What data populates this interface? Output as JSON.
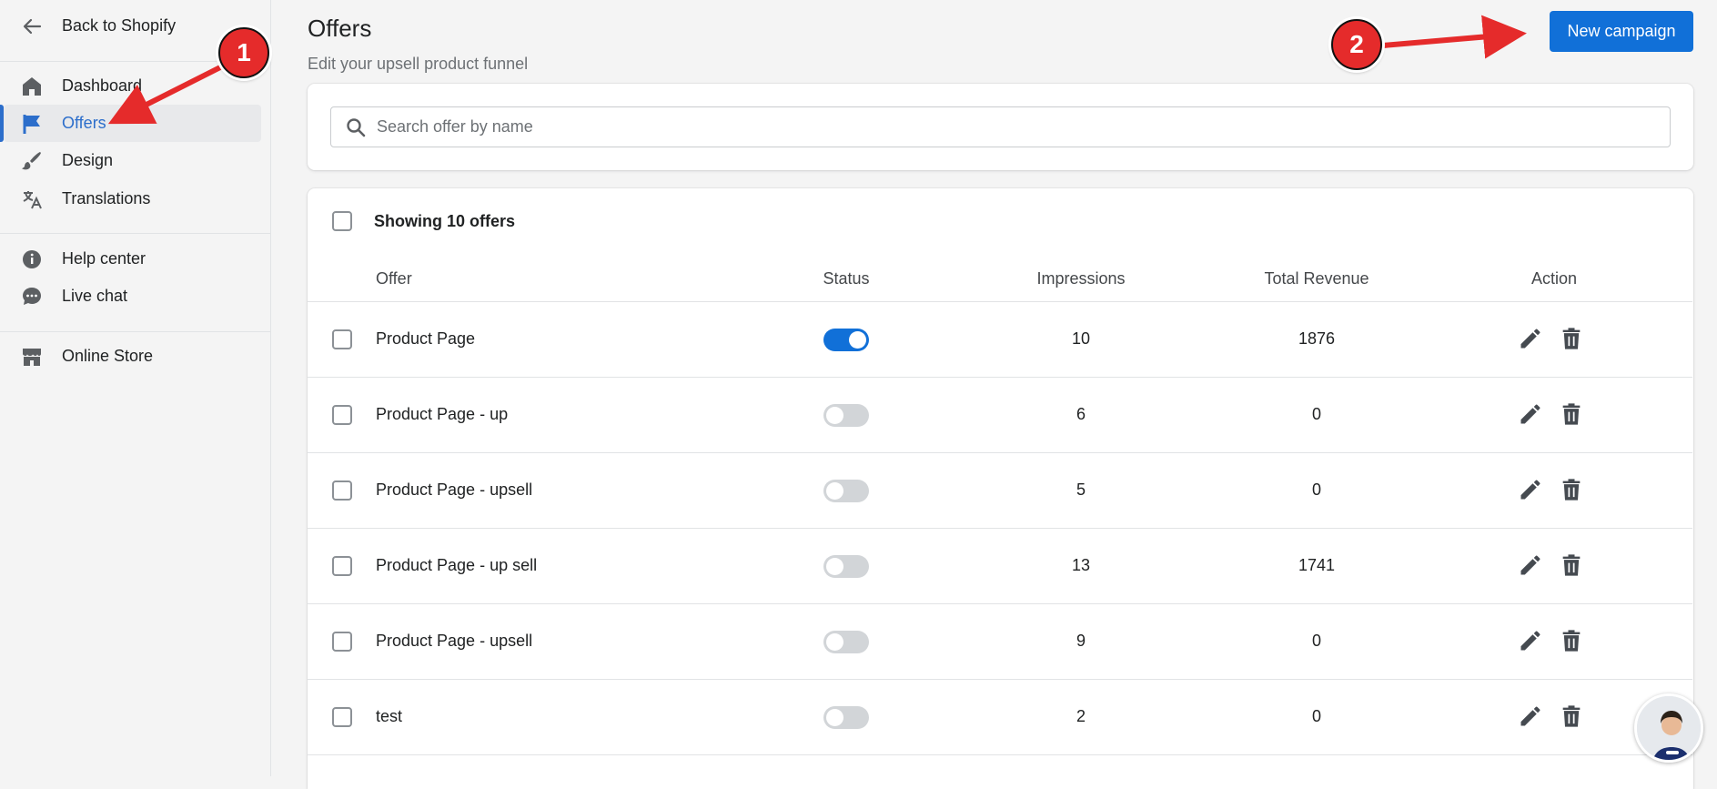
{
  "sidebar": {
    "back_label": "Back to Shopify",
    "items": [
      {
        "label": "Dashboard",
        "icon": "home-icon"
      },
      {
        "label": "Offers",
        "icon": "flag-icon",
        "active": true
      },
      {
        "label": "Design",
        "icon": "brush-icon"
      },
      {
        "label": "Translations",
        "icon": "translate-icon"
      }
    ],
    "help_items": [
      {
        "label": "Help center",
        "icon": "info-icon"
      },
      {
        "label": "Live chat",
        "icon": "chat-icon"
      }
    ],
    "store_item": {
      "label": "Online Store",
      "icon": "store-icon"
    }
  },
  "header": {
    "title": "Offers",
    "subtitle": "Edit your upsell product funnel",
    "new_campaign_label": "New campaign"
  },
  "search": {
    "placeholder": "Search offer by name",
    "value": ""
  },
  "table": {
    "showing_label": "Showing 10 offers",
    "columns": [
      "Offer",
      "Status",
      "Impressions",
      "Total Revenue",
      "Action"
    ],
    "rows": [
      {
        "name": "Product Page",
        "status_on": true,
        "impressions": "10",
        "revenue": "1876"
      },
      {
        "name": "Product Page - up",
        "status_on": false,
        "impressions": "6",
        "revenue": "0"
      },
      {
        "name": "Product Page - upsell",
        "status_on": false,
        "impressions": "5",
        "revenue": "0"
      },
      {
        "name": "Product Page - up sell",
        "status_on": false,
        "impressions": "13",
        "revenue": "1741"
      },
      {
        "name": "Product Page - upsell",
        "status_on": false,
        "impressions": "9",
        "revenue": "0"
      },
      {
        "name": "test",
        "status_on": false,
        "impressions": "2",
        "revenue": "0"
      }
    ]
  },
  "annotations": {
    "badge_1": "1",
    "badge_2": "2",
    "color": "#e52b2b"
  },
  "colors": {
    "accent": "#1170d8",
    "active_nav": "#2c6ecb"
  }
}
